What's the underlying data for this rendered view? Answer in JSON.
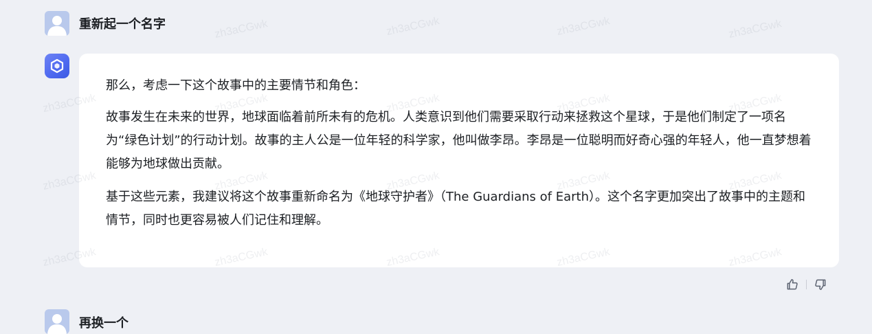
{
  "conversation": {
    "user_message": "重新起一个名字",
    "bot_paragraphs": [
      "那么，考虑一下这个故事中的主要情节和角色：",
      "故事发生在未来的世界，地球面临着前所未有的危机。人类意识到他们需要采取行动来拯救这个星球，于是他们制定了一项名为“绿色计划”的行动计划。故事的主人公是一位年轻的科学家，他叫做李昂。李昂是一位聪明而好奇心强的年轻人，他一直梦想着能够为地球做出贡献。",
      "基于这些元素，我建议将这个故事重新命名为《地球守护者》（The Guardians of Earth）。这个名字更加突出了故事中的主题和情节，同时也更容易被人们记住和理解。"
    ],
    "next_user_message_partial": "再换一个"
  },
  "feedback": {
    "like_icon": "thumbs-up-icon",
    "dislike_icon": "thumbs-down-icon"
  },
  "watermark": {
    "text": "zh3aCGwk"
  },
  "colors": {
    "page_bg": "#eef0f5",
    "bubble_bg": "#ffffff",
    "bot_avatar_accent": "#4f6af0",
    "user_avatar_bg": "#b9c9ec",
    "icon_color": "#5b6270"
  }
}
